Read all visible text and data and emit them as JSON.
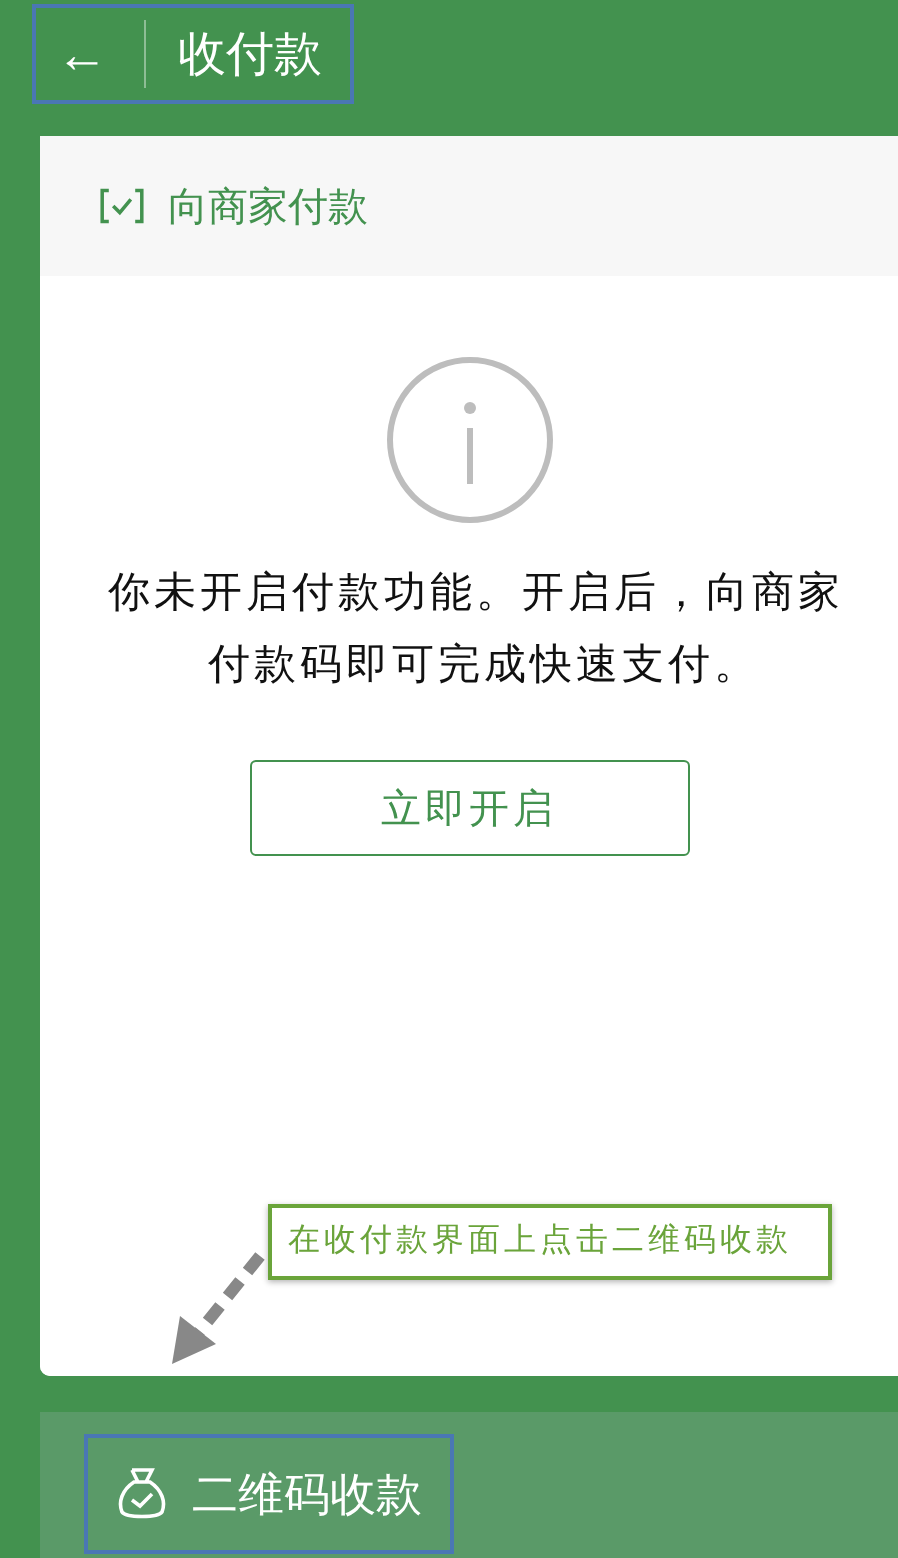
{
  "header": {
    "back": "←",
    "title": "收付款"
  },
  "card": {
    "title": "向商家付款",
    "message_lines": [
      "你未开启付款功能。开启后，向商家",
      "付款码即可完成快速支付。"
    ],
    "button": "立即开启"
  },
  "callout": {
    "text": "在收付款界面上点击二维码收款"
  },
  "bottom_bar": {
    "label": "二维码收款"
  }
}
